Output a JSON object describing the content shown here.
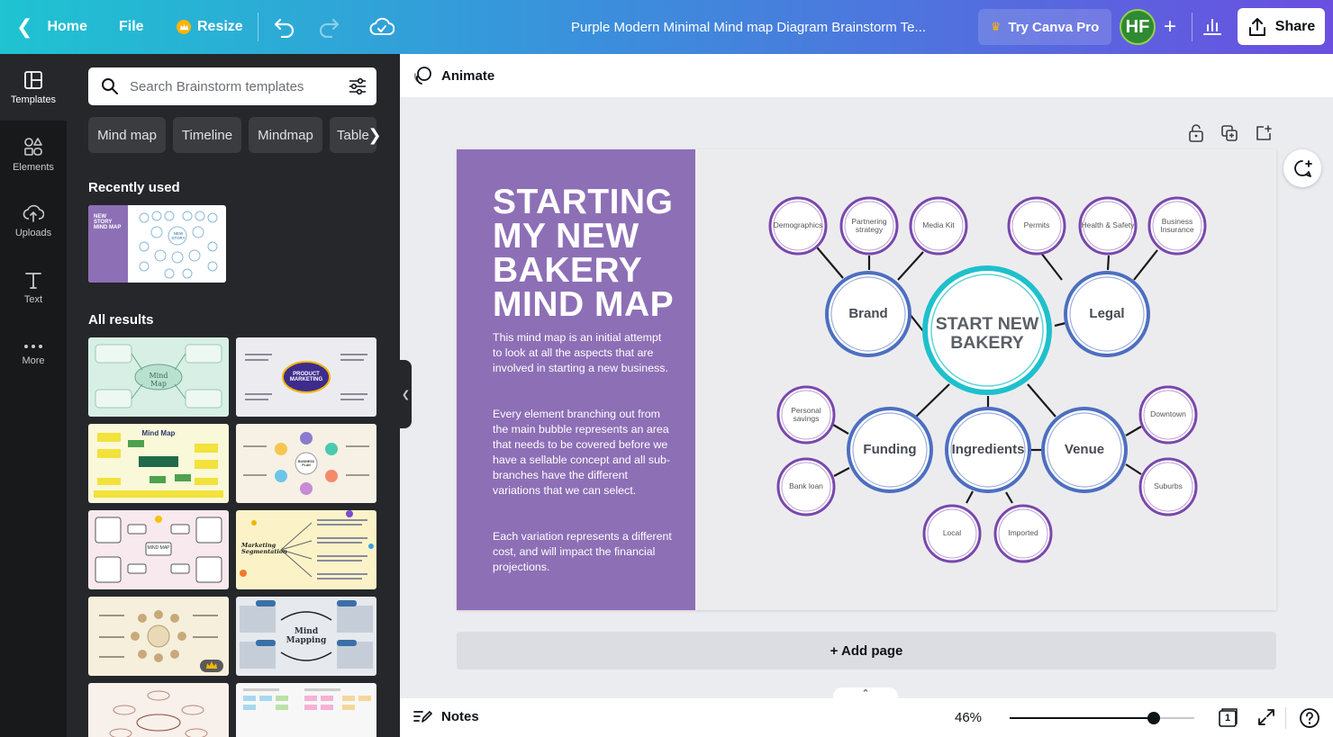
{
  "topbar": {
    "home_label": "Home",
    "file_label": "File",
    "resize_label": "Resize",
    "doc_title": "Purple Modern Minimal  Mind map Diagram Brainstorm Te...",
    "pro_label": "Try Canva Pro",
    "avatar_initials": "HF",
    "share_label": "Share"
  },
  "rail": [
    {
      "label": "Templates",
      "icon": "templates-icon",
      "active": true
    },
    {
      "label": "Elements",
      "icon": "elements-icon"
    },
    {
      "label": "Uploads",
      "icon": "upload-cloud-icon"
    },
    {
      "label": "Text",
      "icon": "text-icon"
    },
    {
      "label": "More",
      "icon": "more-dots-icon"
    }
  ],
  "panel": {
    "search_placeholder": "Search Brainstorm templates",
    "chips": [
      "Mind map",
      "Timeline",
      "Mindmap",
      "Table"
    ],
    "recently_used_title": "Recently used",
    "all_results_title": "All results",
    "recent_thumb_text": {
      "left": "NEW STORY MIND MAP",
      "center": "NEW STORY"
    },
    "result_thumbs": [
      {
        "text": "Mind Map",
        "bg": "#d7efe4"
      },
      {
        "text": "PRODUCT MARKETING",
        "bg": "#ecebef"
      },
      {
        "text": "Mind Map",
        "bg": "#f9f8d8"
      },
      {
        "text": "BUSINESS PLAN",
        "bg": "#f6f1e4"
      },
      {
        "text": "MIND MAP",
        "bg": "#f8e9ee"
      },
      {
        "text": "Marketing Segmentation",
        "bg": "#fbf3c7"
      },
      {
        "text": "",
        "bg": "#f6efdc"
      },
      {
        "text": "Mind Mapping",
        "bg": "#e6e9ee"
      },
      {
        "text": "",
        "bg": "#f8f0ea"
      },
      {
        "text": "",
        "bg": "#f7f7f7"
      }
    ]
  },
  "editor": {
    "animate_label": "Animate",
    "add_page_label": "+ Add page",
    "notes_label": "Notes",
    "zoom_level": "46%",
    "zoom_fraction": 0.46,
    "page_number": "1"
  },
  "design": {
    "title": "STARTING MY NEW BAKERY MIND MAP",
    "paragraphs": [
      "This mind map is an initial attempt to look at all the aspects that are involved in starting a new business.",
      "Every element branching out from the main bubble represents an area that needs to be covered before we have a sellable concept and all sub-branches have the different variations that we can select.",
      "Each variation represents a different cost, and will impact the financial projections."
    ],
    "center_node": "START NEW BAKERY",
    "main_nodes": [
      "Brand",
      "Legal",
      "Funding",
      "Ingredients",
      "Venue"
    ],
    "sub_nodes": {
      "brand": [
        "Demographics",
        "Partnering strategy",
        "Media Kit"
      ],
      "legal": [
        "Permits",
        "Health & Safety",
        "Business Insurance"
      ],
      "funding": [
        "Personal savings",
        "Bank loan"
      ],
      "ingredients": [
        "Local",
        "Imported"
      ],
      "venue": [
        "Downtown",
        "Suburbs"
      ]
    },
    "colors": {
      "panel": "#8d6fb6",
      "center_ring": "#1ec0cc",
      "main_ring": "#4d6fc0",
      "sub_ring": "#7a47ad"
    }
  }
}
